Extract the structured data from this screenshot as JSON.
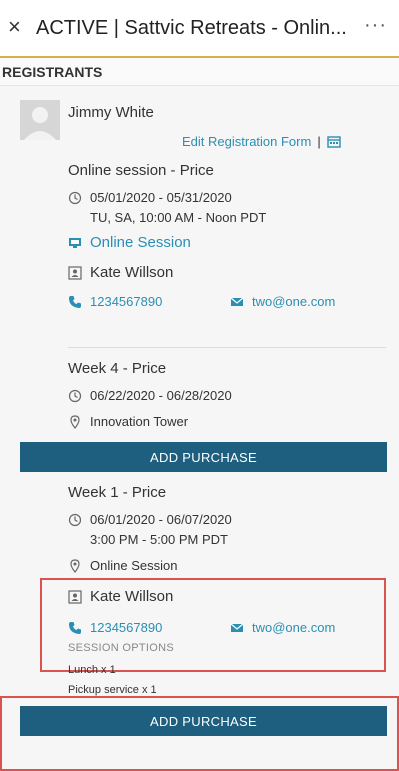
{
  "window": {
    "close_glyph": "×",
    "title": "ACTIVE | Sattvic Retreats - Onlin...",
    "more_glyph": "···"
  },
  "section": {
    "header": "REGISTRANTS"
  },
  "registrant": {
    "name": "Jimmy White",
    "edit_link": "Edit Registration Form",
    "separator": "|"
  },
  "purchases": [
    {
      "title": "Online session - Price",
      "dates": "05/01/2020 - 05/31/2020",
      "times": "TU, SA, 10:00 AM - Noon PDT",
      "location": "Online Session",
      "instructor": "Kate Willson",
      "phone": "1234567890",
      "email": "two@one.com"
    },
    {
      "title": "Week 4 - Price",
      "dates": "06/22/2020 - 06/28/2020",
      "location": "Innovation Tower",
      "button": "ADD PURCHASE"
    },
    {
      "title": "Week 1 - Price",
      "dates": "06/01/2020 - 06/07/2020",
      "times": "3:00 PM - 5:00 PM PDT",
      "location": "Online Session",
      "instructor": "Kate Willson",
      "phone": "1234567890",
      "email": "two@one.com",
      "options_header": "SESSION OPTIONS",
      "options": [
        "Lunch  x 1",
        "Pickup service  x 1"
      ],
      "button": "ADD PURCHASE"
    }
  ],
  "colors": {
    "accent": "#1e5e7e",
    "link": "#2a8fb3",
    "highlight": "#d9534f"
  },
  "icons": [
    "close-icon",
    "more-icon",
    "clock-icon",
    "monitor-icon",
    "id-card-icon",
    "phone-icon",
    "mail-icon",
    "location-pin-icon",
    "calendar-icon",
    "avatar-icon"
  ]
}
